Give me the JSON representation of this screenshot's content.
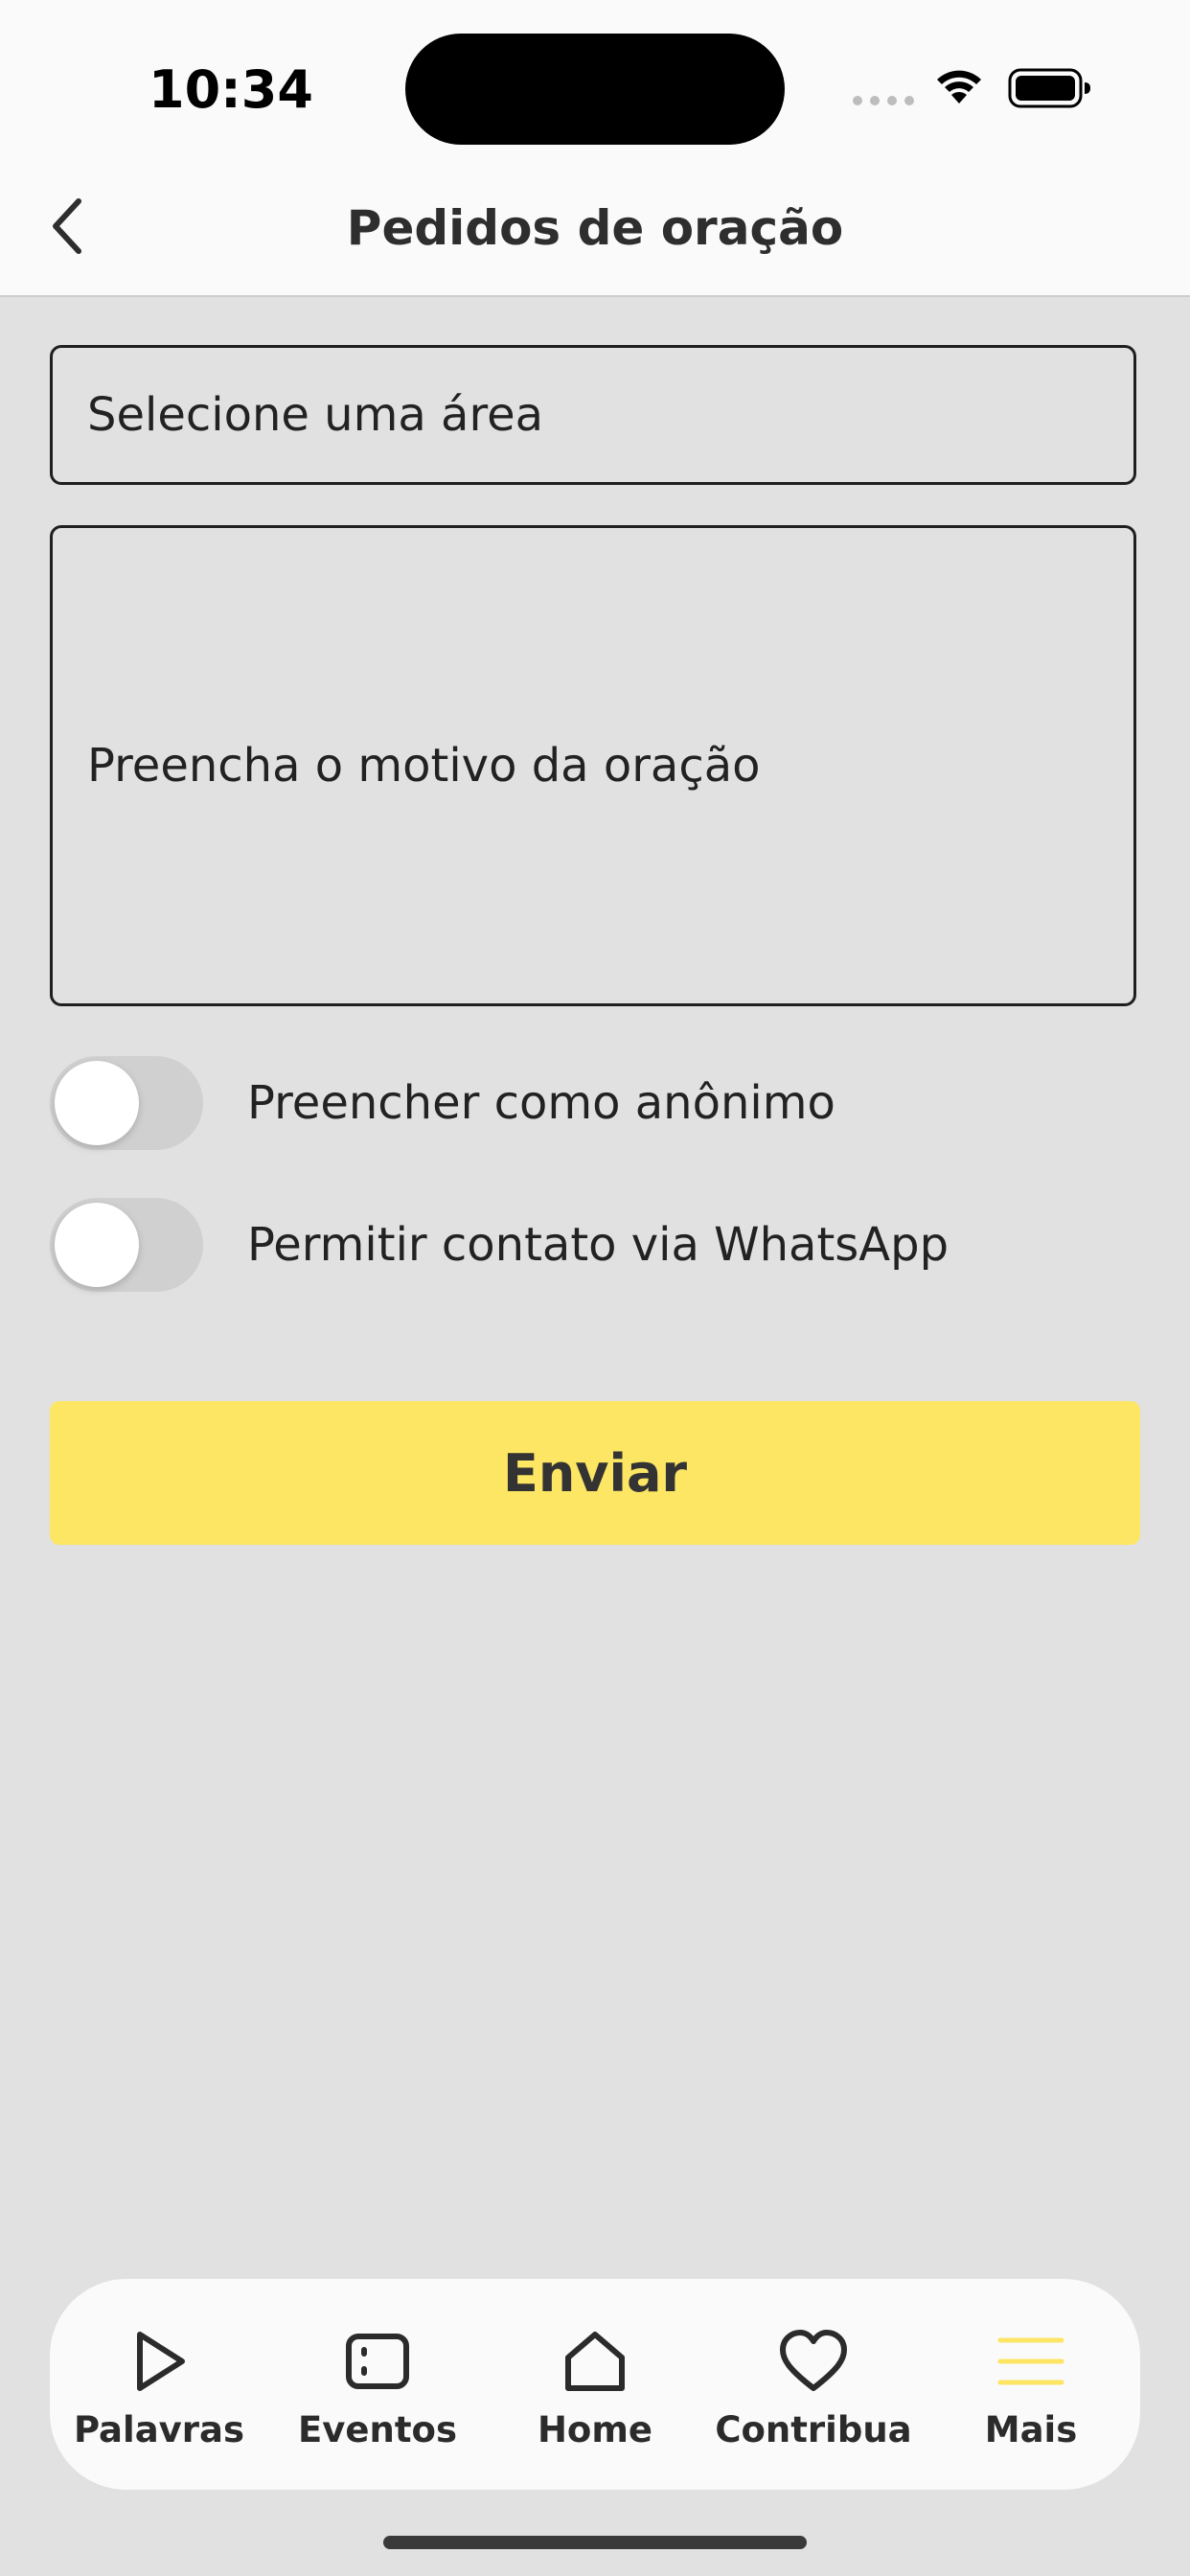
{
  "status_bar": {
    "time": "10:34"
  },
  "header": {
    "title": "Pedidos de oração",
    "back_icon": "chevron-left-icon"
  },
  "form": {
    "area_placeholder": "Selecione uma área",
    "reason_placeholder": "Preencha o motivo da oração",
    "toggles": [
      {
        "label": "Preencher como anônimo",
        "checked": false
      },
      {
        "label": "Permitir contato via WhatsApp",
        "checked": false
      }
    ],
    "submit_label": "Enviar"
  },
  "tab_bar": {
    "items": [
      {
        "label": "Palavras",
        "icon": "play-icon",
        "active": false
      },
      {
        "label": "Eventos",
        "icon": "calendar-icon",
        "active": false
      },
      {
        "label": "Home",
        "icon": "home-icon",
        "active": false
      },
      {
        "label": "Contribua",
        "icon": "heart-icon",
        "active": false
      },
      {
        "label": "Mais",
        "icon": "menu-icon",
        "active": true
      }
    ]
  },
  "colors": {
    "accent": "#fce664",
    "background": "#e1e1e1",
    "surface": "#fafafa",
    "text": "#2b2b2b"
  }
}
